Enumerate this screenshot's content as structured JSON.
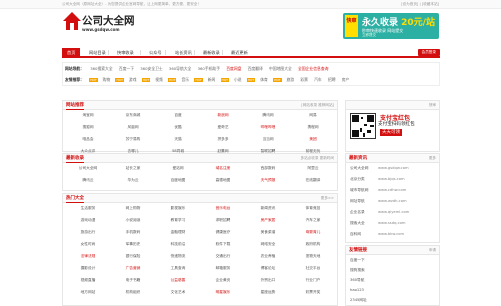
{
  "topbar": {
    "text": "公司大全网（原网址大全）- 为您提供企业官网导航，让上网更简单、更方便、更安全！",
    "right": "[设为首页] | [收藏本站]"
  },
  "logo": {
    "name": "公司大全网",
    "url": "www.gsdqw.com"
  },
  "ad": {
    "badge": "快审",
    "headline": "永久收录",
    "price": "20元/站",
    "line2": "秒审快速收录 网站提交",
    "line3": "立即提交"
  },
  "nav": {
    "items": [
      "首页",
      "网站目录",
      "快审收录",
      "公众号",
      "站长资讯",
      "最新收录",
      "最近更新"
    ],
    "login": "会员登录"
  },
  "hot": {
    "row1_label": "网站导航：",
    "row1_items": [
      "360搜索大全",
      "百度一下",
      "360安全卫士",
      "360导航大全",
      "360手机助手",
      "百度网盘",
      "百度翻译",
      "中国地图大全",
      "全国企业信息查询"
    ],
    "row2_label": "友情推荐：",
    "row2_items": [
      "购物",
      "游戏",
      "视频",
      "音乐",
      "新闻",
      "小说",
      "体育",
      "旅游",
      "彩票",
      "汽车",
      "招聘",
      "房产"
    ]
  },
  "panels": [
    {
      "title": "网站推荐",
      "right": "[网站收录 推荐网站]",
      "cells": [
        "淘宝网",
        "京东商城",
        "百度",
        "新浪网",
        "腾讯网",
        "网易",
        "搜狐网",
        "凤凰网",
        "优酷",
        "爱奇艺",
        "哔哩哔哩",
        "携程网",
        "唯品会",
        "苏宁易购",
        "天猫",
        "拼多多",
        "当当网",
        "美团",
        "大众点评",
        "去哪儿",
        "58同城",
        "赶集网",
        "智联招聘",
        "前程无忧"
      ]
    },
    {
      "title": "最新收录",
      "right": "多站点收录 更新时间",
      "cells": [
        "公司大全网",
        "站长之家",
        "爱站网",
        "域名注册",
        "西部数码",
        "阿里云",
        "腾讯云",
        "华为云",
        "百度地图",
        "高德地图",
        "天气预报",
        "在线翻译"
      ]
    },
    {
      "title": "热门大全",
      "right": "更多>>",
      "cells": [
        "生活服务",
        "网上购物",
        "影视娱乐",
        "音乐电台",
        "新闻资讯",
        "体育竞技",
        "游戏动漫",
        "小说阅读",
        "教育学习",
        "求职招聘",
        "房产家居",
        "汽车之家",
        "旅游出行",
        "手机数码",
        "金融理财",
        "健康医疗",
        "美食菜谱",
        "母婴育儿",
        "女性时尚",
        "军事历史",
        "科技前沿",
        "软件下载",
        "网络安全",
        "政府机构",
        "法律法规",
        "银行保险",
        "快递物流",
        "交通出行",
        "农业养殖",
        "宠物天地",
        "摄影设计",
        "广告营销",
        "工具查询",
        "邮箱服务",
        "博客论坛",
        "社交平台",
        "视频直播",
        "电子书籍",
        "公益慈善",
        "企业黄页",
        "外贸出口",
        "行业门户",
        "地方网站",
        "机构组织",
        "文化艺术",
        "明星娱乐",
        "星座运势",
        "彩票开奖"
      ]
    }
  ],
  "side": {
    "pay_title": "快审",
    "pay_headline": "支付宝红包",
    "pay_line2": "支付宝扫码领红包",
    "pay_button": "天天可领",
    "news_title": "最新资讯",
    "news_right": "更多",
    "news": [
      {
        "name": "公司大全网",
        "url": "www.gsdqw.com"
      },
      {
        "name": "北京分类",
        "url": "www.bjqs.com"
      },
      {
        "name": "城市导航网",
        "url": "www.cdhw.com"
      },
      {
        "name": "网址导航",
        "url": "www.wzdh.com"
      },
      {
        "name": "企业名录",
        "url": "www.qiyeml.com"
      },
      {
        "name": "搜索大全",
        "url": "www.ssdq.com"
      },
      {
        "name": "百科网",
        "url": "www.bkw.com"
      }
    ],
    "link_title": "友情链接",
    "link_right": "申请",
    "links": [
      "百度一下",
      "搜狗搜索",
      "360导航",
      "hao123",
      "2345网址"
    ]
  }
}
